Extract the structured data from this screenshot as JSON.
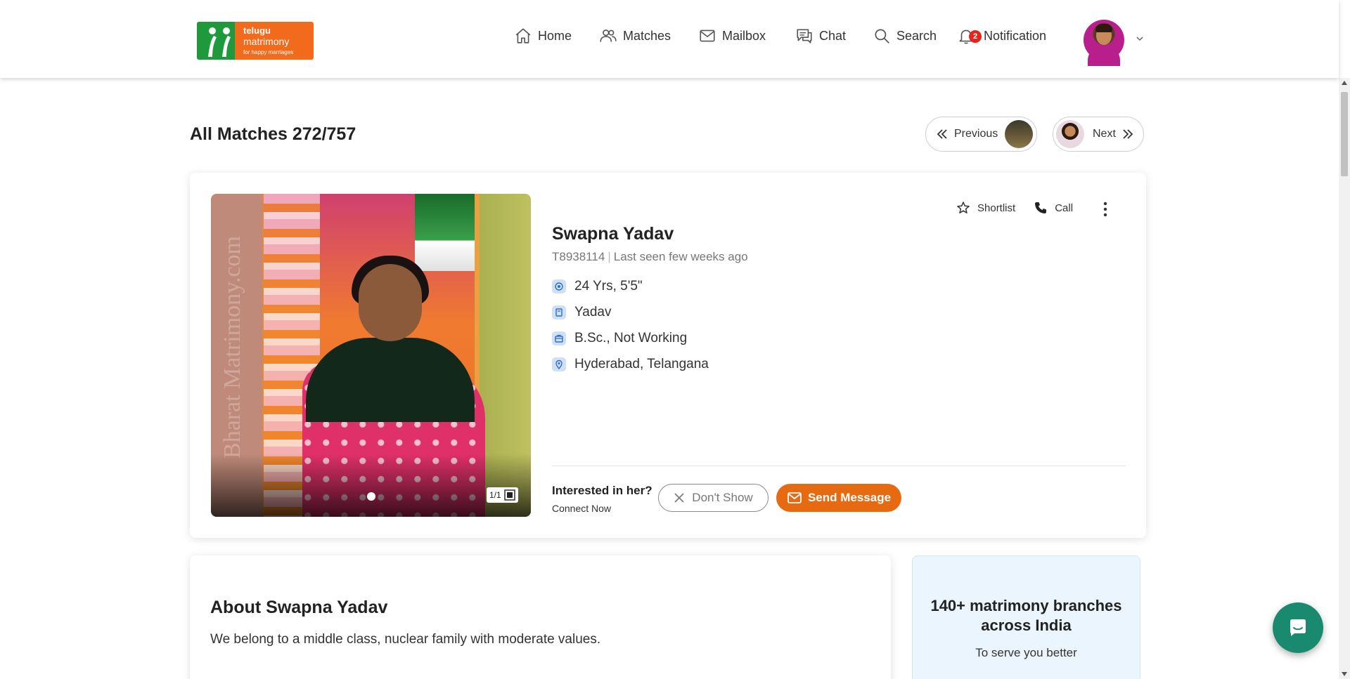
{
  "brand": {
    "line1": "telugu",
    "line2": "matrimony",
    "tagline": "for happy marriages",
    "colors": {
      "orange": "#f26a1b",
      "green": "#1e9a3c"
    }
  },
  "nav": [
    {
      "label": "Home",
      "icon": "home-icon"
    },
    {
      "label": "Matches",
      "icon": "users-icon"
    },
    {
      "label": "Mailbox",
      "icon": "mail-icon"
    },
    {
      "label": "Chat",
      "icon": "chat-icon"
    },
    {
      "label": "Search",
      "icon": "search-icon"
    },
    {
      "label": "Notification",
      "icon": "bell-icon",
      "badge": "2"
    }
  ],
  "page": {
    "title": "All Matches 272/757",
    "prev_label": "Previous",
    "next_label": "Next"
  },
  "profile": {
    "name": "Swapna Yadav",
    "id": "T8938114",
    "last_seen": "Last seen few weeks ago",
    "age_height": "24 Yrs, 5'5\"",
    "caste": "Yadav",
    "education": "B.Sc., Not Working",
    "location": "Hyderabad, Telangana",
    "photo_count": "1/1",
    "watermark": "Bharat Matrimony.com"
  },
  "actions": {
    "shortlist": "Shortlist",
    "call": "Call",
    "interest_question": "Interested in her?",
    "connect_now": "Connect Now",
    "dont_show": "Don't Show",
    "send_message": "Send Message",
    "accent": "#e66a12"
  },
  "about": {
    "heading": "About Swapna Yadav",
    "text": "We belong to a middle class, nuclear family with moderate values."
  },
  "promo": {
    "heading": "140+ matrimony branches across India",
    "sub": "To serve you better"
  }
}
